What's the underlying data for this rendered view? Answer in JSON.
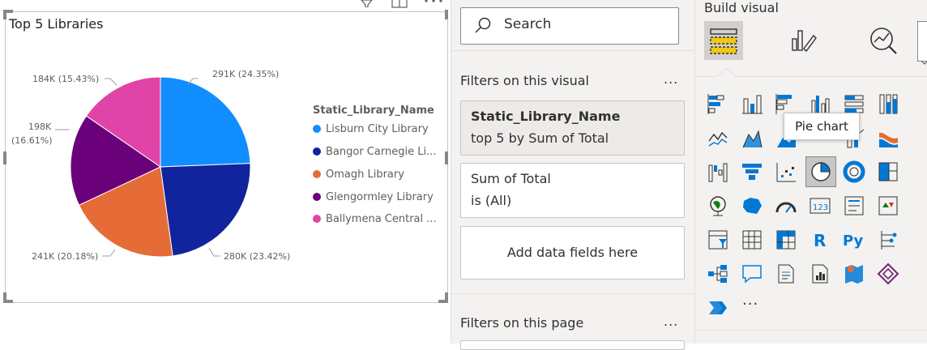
{
  "visual": {
    "title": "Top 5 Libraries",
    "legend_title": "Static_Library_Name",
    "legend_items": [
      {
        "label": "Lisburn City Library",
        "color": "#118dff"
      },
      {
        "label": "Bangor Carnegie Li...",
        "color": "#12239e"
      },
      {
        "label": "Omagh Library",
        "color": "#e66c37"
      },
      {
        "label": "Glengormley Library",
        "color": "#6b007b"
      },
      {
        "label": "Ballymena Central ...",
        "color": "#e044a7"
      }
    ],
    "labels": {
      "lisburn": "291K (24.35%)",
      "bangor": "280K (23.42%)",
      "omagh": "241K (20.18%)",
      "glen_1": "198K",
      "glen_2": "(16.61%)",
      "bally": "184K (15.43%)"
    }
  },
  "chart_data": {
    "type": "pie",
    "title": "Top 5 Libraries",
    "legend_title": "Static_Library_Name",
    "legend_placement": "right",
    "slices": [
      {
        "name": "Lisburn City Library",
        "value": 291,
        "percent": 24.35,
        "label": "291K (24.35%)",
        "color": "#118dff"
      },
      {
        "name": "Bangor Carnegie Library",
        "value": 280,
        "percent": 23.42,
        "label": "280K (23.42%)",
        "color": "#12239e"
      },
      {
        "name": "Omagh Library",
        "value": 241,
        "percent": 20.18,
        "label": "241K (20.18%)",
        "color": "#e66c37"
      },
      {
        "name": "Glengormley Library",
        "value": 198,
        "percent": 16.61,
        "label": "198K (16.61%)",
        "color": "#6b007b"
      },
      {
        "name": "Ballymena Central Library",
        "value": 184,
        "percent": 15.43,
        "label": "184K (15.43%)",
        "color": "#e044a7"
      }
    ]
  },
  "filters": {
    "search_label": "Search",
    "on_visual": "Filters on this visual",
    "more": "...",
    "card1_title": "Static_Library_Name",
    "card1_sub": "top 5 by Sum of Total",
    "card2_title": "Sum of Total",
    "card2_sub": "is (All)",
    "add_fields": "Add data fields here",
    "on_page": "Filters on this page",
    "more2": "..."
  },
  "build": {
    "title": "Build visual",
    "tooltip": "Pie chart",
    "more": "...",
    "r_label": "R",
    "py_label": "Py",
    "kpi_label": "123"
  },
  "colors": {
    "accent": "#f2c811",
    "chart_blue": "#118dff",
    "icon_blue": "#0078d4"
  }
}
